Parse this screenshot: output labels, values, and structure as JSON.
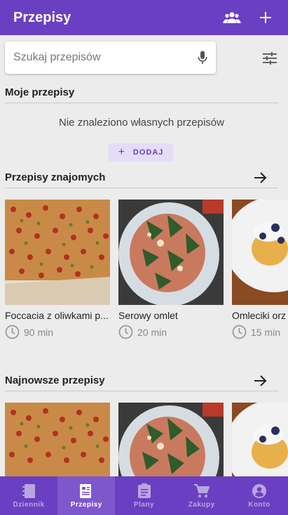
{
  "appbar": {
    "title": "Przepisy",
    "friends_icon": "people-icon",
    "add_icon": "plus-icon"
  },
  "search": {
    "placeholder": "Szukaj przepisów",
    "value": "",
    "mic_icon": "mic-icon",
    "filter_icon": "tune-icon"
  },
  "my_recipes": {
    "title": "Moje przepisy",
    "empty_text": "Nie znaleziono własnych przepisów",
    "add_label": "DODAJ",
    "add_icon": "plus-icon"
  },
  "friends_recipes": {
    "title": "Przepisy znajomych",
    "items": [
      {
        "name": "Foccacia z oliwkami p...",
        "time": "90 min",
        "image": "focaccia"
      },
      {
        "name": "Serowy omlet",
        "time": "20 min",
        "image": "omelet"
      },
      {
        "name": "Omleciki orz",
        "time": "15 min",
        "image": "pancakes"
      }
    ]
  },
  "newest_recipes": {
    "title": "Najnowsze przepisy",
    "items": [
      {
        "image": "focaccia"
      },
      {
        "image": "omelet"
      },
      {
        "image": "pancakes"
      }
    ]
  },
  "bottom_nav": {
    "items": [
      {
        "label": "Dziennik",
        "icon": "notebook-icon",
        "active": false
      },
      {
        "label": "Przepisy",
        "icon": "recipe-book-icon",
        "active": true
      },
      {
        "label": "Plany",
        "icon": "clipboard-icon",
        "active": false
      },
      {
        "label": "Zakupy",
        "icon": "cart-icon",
        "active": false
      },
      {
        "label": "Konto",
        "icon": "account-icon",
        "active": false
      }
    ]
  },
  "colors": {
    "primary": "#6a3fc1",
    "active_tab": "#7f57cc",
    "inactive_tab_text": "#b7a6e0",
    "background": "#ececec",
    "add_button_bg": "#e5dcf7"
  }
}
